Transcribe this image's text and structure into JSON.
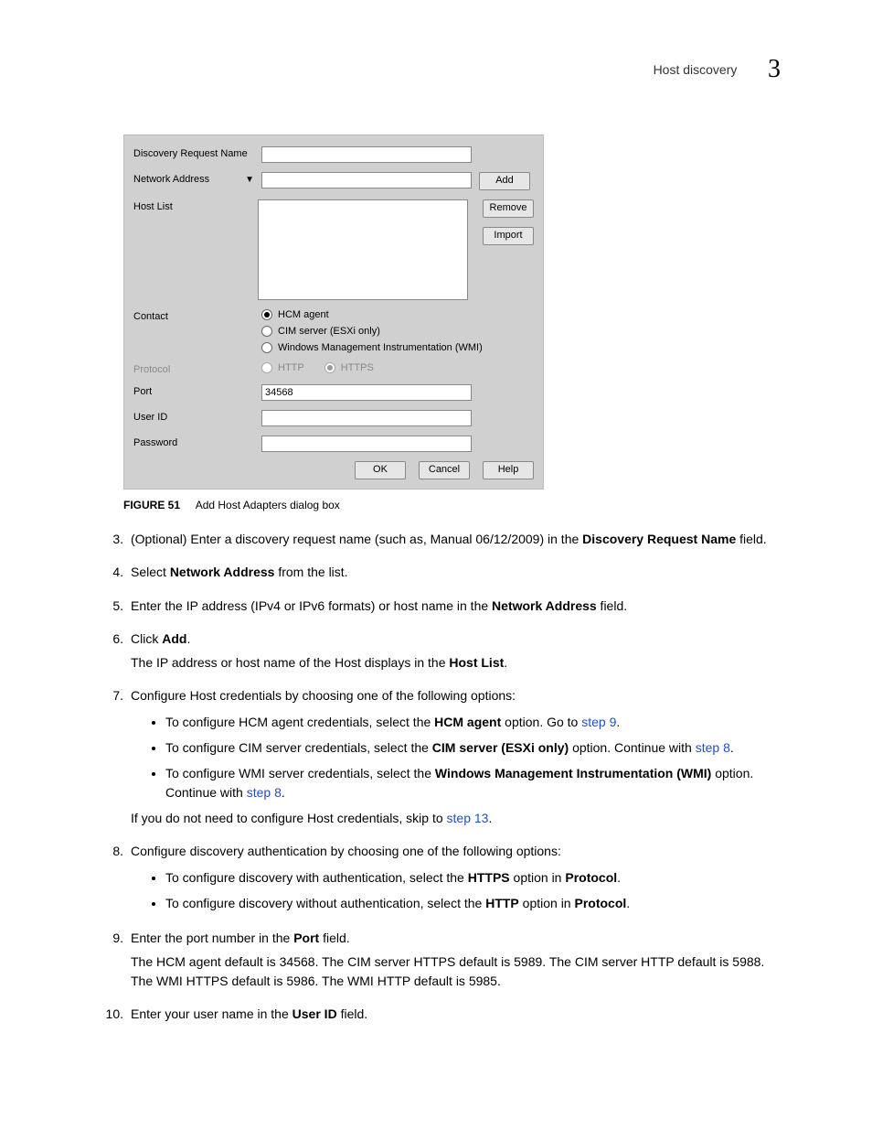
{
  "header": {
    "title": "Host discovery",
    "chapter": "3"
  },
  "dialog": {
    "labels": {
      "discovery_request_name": "Discovery Request Name",
      "network_address": "Network Address",
      "host_list": "Host List",
      "contact": "Contact",
      "protocol": "Protocol",
      "port": "Port",
      "user_id": "User ID",
      "password": "Password"
    },
    "contact_options": {
      "hcm_agent": "HCM agent",
      "cim_server": "CIM server (ESXi only)",
      "wmi": "Windows Management Instrumentation (WMI)"
    },
    "protocol_options": {
      "http": "HTTP",
      "https": "HTTPS"
    },
    "port_value": "34568",
    "buttons": {
      "add": "Add",
      "remove": "Remove",
      "import": "Import",
      "ok": "OK",
      "cancel": "Cancel",
      "help": "Help"
    }
  },
  "figure": {
    "number": "FIGURE 51",
    "caption": "Add Host Adapters dialog box"
  },
  "steps": {
    "s3": {
      "num": "3.",
      "t1": "(Optional) Enter a discovery request name (such as, Manual 06/12/2009) in the ",
      "b1": "Discovery Request Name",
      "t2": " field."
    },
    "s4": {
      "num": "4.",
      "t1": "Select ",
      "b1": "Network Address",
      "t2": " from the list."
    },
    "s5": {
      "num": "5.",
      "t1": "Enter the IP address (IPv4 or IPv6 formats) or host name in the ",
      "b1": "Network Address",
      "t2": " field."
    },
    "s6": {
      "num": "6.",
      "t1": "Click ",
      "b1": "Add",
      "t2": ".",
      "p2a": "The IP address or host name of the Host displays in the ",
      "p2b": "Host List",
      "p2c": "."
    },
    "s7": {
      "num": "7.",
      "t1": "Configure Host credentials by choosing one of the following options:",
      "b1a": "To configure HCM agent credentials, select the ",
      "b1b": "HCM agent",
      "b1c": " option. Go to ",
      "b1d": "step 9",
      "b1e": ".",
      "b2a": "To configure CIM server credentials, select the ",
      "b2b": "CIM server (ESXi only)",
      "b2c": " option. Continue with ",
      "b2d": "step 8",
      "b2e": ".",
      "b3a": "To configure WMI server credentials, select the ",
      "b3b": "Windows Management Instrumentation (WMI)",
      "b3c": " option. Continue with ",
      "b3d": "step 8",
      "b3e": ".",
      "p2a": "If you do not need to configure Host credentials, skip to ",
      "p2b": "step 13",
      "p2c": "."
    },
    "s8": {
      "num": "8.",
      "t1": "Configure discovery authentication by choosing one of the following options:",
      "b1a": "To configure discovery with authentication, select the ",
      "b1b": "HTTPS",
      "b1c": " option in ",
      "b1d": "Protocol",
      "b1e": ".",
      "b2a": "To configure discovery without authentication, select the ",
      "b2b": "HTTP",
      "b2c": " option in ",
      "b2d": "Protocol",
      "b2e": "."
    },
    "s9": {
      "num": "9.",
      "t1": "Enter the port number in the ",
      "b1": "Port",
      "t2": " field.",
      "p2": "The HCM agent default is 34568. The CIM server HTTPS default is 5989. The CIM server HTTP default is 5988. The WMI HTTPS default is 5986. The WMI HTTP default is 5985."
    },
    "s10": {
      "num": "10.",
      "t1": "Enter your user name in the ",
      "b1": "User ID",
      "t2": " field."
    }
  }
}
